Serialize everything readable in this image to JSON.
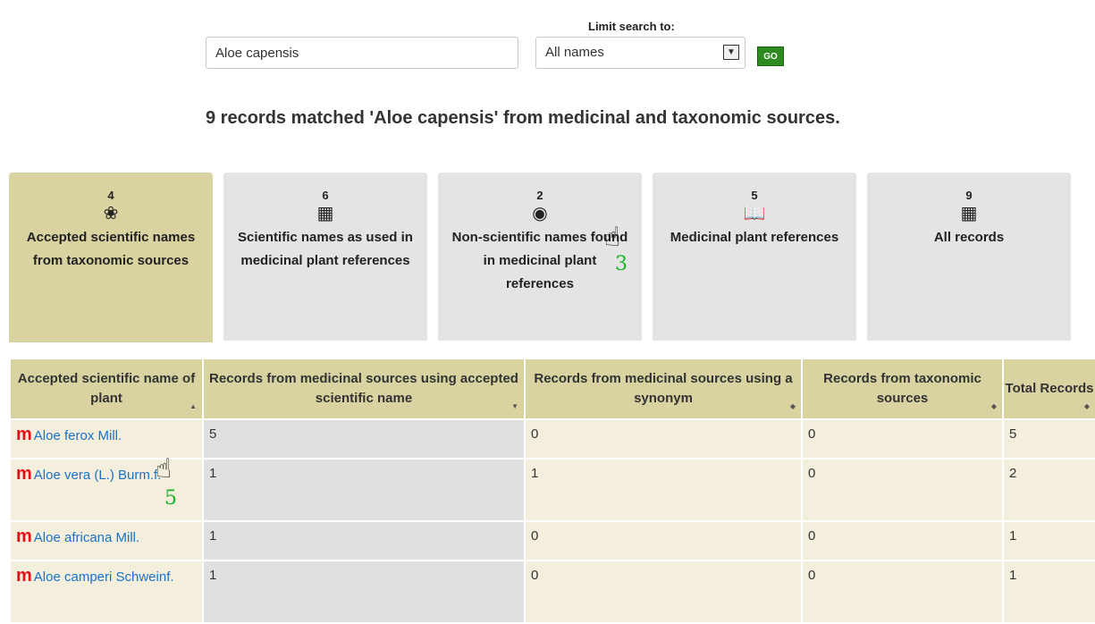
{
  "search": {
    "limit_label": "Limit search to:",
    "query_value": "Aloe capensis",
    "query_placeholder": "",
    "limit_selected": "All names",
    "go_label": "GO"
  },
  "result_heading": "9 records matched 'Aloe capensis' from medicinal and taxonomic sources.",
  "tabs": [
    {
      "count": "4",
      "icon": "plant-icon",
      "label": "Accepted scientific names from taxonomic sources",
      "active": true
    },
    {
      "count": "6",
      "icon": "document-icon",
      "label": "Scientific names as used in medicinal plant references",
      "active": false
    },
    {
      "count": "2",
      "icon": "globe-icon",
      "label": "Non-scientific names found in medicinal plant references",
      "active": false
    },
    {
      "count": "5",
      "icon": "book-icon",
      "label": "Medicinal plant references",
      "active": false
    },
    {
      "count": "9",
      "icon": "table-icon",
      "label": "All records",
      "active": false
    }
  ],
  "table": {
    "columns": [
      "Accepted scientific name of plant",
      "Records from medicinal sources using accepted scientific name",
      "Records from medicinal sources using a synonym",
      "Records from taxonomic sources",
      "Total Records"
    ],
    "rows": [
      {
        "mark": "m",
        "name": "Aloe ferox Mill.",
        "accepted": "5",
        "synonym": "0",
        "taxonomic": "0",
        "total": "5"
      },
      {
        "mark": "m",
        "name": "Aloe vera (L.) Burm.f.",
        "accepted": "1",
        "synonym": "1",
        "taxonomic": "0",
        "total": "2"
      },
      {
        "mark": "m",
        "name": "Aloe africana Mill.",
        "accepted": "1",
        "synonym": "0",
        "taxonomic": "0",
        "total": "1"
      },
      {
        "mark": "m",
        "name": "Aloe camperi Schweinf.",
        "accepted": "1",
        "synonym": "0",
        "taxonomic": "0",
        "total": "1"
      }
    ]
  },
  "annotations": {
    "step_a": "3",
    "step_b": "5"
  },
  "colors": {
    "tab_active": "#d8d3a1",
    "tab_inactive": "#e4e4e4",
    "row_bg": "#f4eedd",
    "link": "#1a72c8",
    "mark": "#e0101a",
    "go": "#2e8b1f"
  }
}
